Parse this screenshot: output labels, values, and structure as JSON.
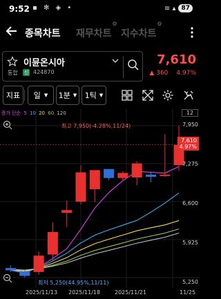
{
  "status": {
    "time": "9:52",
    "battery": "87",
    "left_icons": "▪ ✻ ◈ •",
    "right_icons": "≋ ▴"
  },
  "nav": {
    "tabs": [
      "종목차트",
      "재무차트",
      "지수차트"
    ],
    "active_tab": 0
  },
  "stock": {
    "name": "이뮨온시아",
    "market": "통합",
    "credit": "신",
    "code": "424870",
    "price": "7,610",
    "change_arrow": "▲",
    "change": "360",
    "change_pct": "4.97%"
  },
  "toolbar": {
    "indicator": "지표",
    "period": "일",
    "min": "1분",
    "tick": "1틱"
  },
  "legend": {
    "label": "종가 단순",
    "periods": [
      {
        "value": "5",
        "color": "#e040fb"
      },
      {
        "value": "10",
        "color": "#29b6f6"
      },
      {
        "value": "20",
        "color": "#ffd54f"
      },
      {
        "value": "60",
        "color": "#8bc34a"
      },
      {
        "value": "120",
        "color": "#bdbdbd"
      }
    ],
    "axis_count": "12"
  },
  "annotations": {
    "high": "최고 7,950(-4.28%,11/24)",
    "low": "최저 5,250(44.95%,11/11)"
  },
  "chart_data": {
    "type": "candlestick",
    "up_color": "#e8312f",
    "down_color": "#2f6fd6",
    "y_ticks": [
      "7,950",
      "7,275",
      "6,600",
      "5,925",
      "5,250"
    ],
    "x_ticks": [
      "2025/11/13",
      "2025/11/18",
      "2025/11/21",
      "11/25"
    ],
    "ylim": [
      5250,
      7950
    ],
    "candles": [
      {
        "open": 5420,
        "high": 5470,
        "low": 5350,
        "close": 5380
      },
      {
        "open": 5360,
        "high": 5400,
        "low": 5250,
        "close": 5280
      },
      {
        "open": 5350,
        "high": 5720,
        "low": 5300,
        "close": 5640
      },
      {
        "open": 5660,
        "high": 6230,
        "low": 5560,
        "close": 6060
      },
      {
        "open": 6400,
        "high": 6620,
        "low": 6150,
        "close": 6450
      },
      {
        "open": 6600,
        "high": 7250,
        "low": 6550,
        "close": 7120
      },
      {
        "open": 6820,
        "high": 7150,
        "low": 6590,
        "close": 7160
      },
      {
        "open": 7180,
        "high": 7180,
        "low": 6980,
        "close": 7020
      },
      {
        "open": 7020,
        "high": 7140,
        "low": 6960,
        "close": 7110
      },
      {
        "open": 7030,
        "high": 7320,
        "low": 6890,
        "close": 7280
      },
      {
        "open": 7080,
        "high": 7120,
        "low": 6940,
        "close": 7040
      },
      {
        "open": 7080,
        "high": 7800,
        "low": 7040,
        "close": 7080
      },
      {
        "open": 7250,
        "high": 7950,
        "low": 7150,
        "close": 7610
      }
    ],
    "current_price": "7,610",
    "current_pct": "4.97%"
  }
}
